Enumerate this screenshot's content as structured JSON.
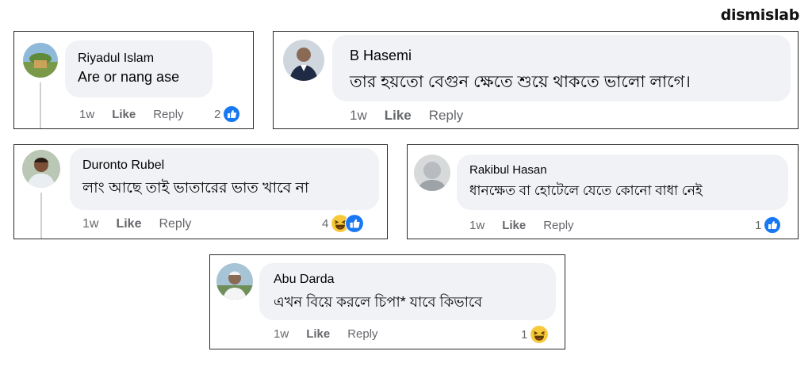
{
  "brand": "dismislab",
  "colors": {
    "like_blue": "#1877f2",
    "bubble_bg": "#f0f2f5",
    "haha_yellow": "#f7c93a"
  },
  "comments": [
    {
      "name": "Riyadul Islam",
      "text": "Are or nang ase",
      "time": "1w",
      "like": "Like",
      "reply": "Reply",
      "reactions": "2",
      "reaction_icons": [
        "like-icon"
      ]
    },
    {
      "name": "B Hasemi",
      "text": "তার হয়তো বেগুন ক্ষেতে শুয়ে থাকতে ভালো লাগে।",
      "time": "1w",
      "like": "Like",
      "reply": "Reply",
      "reactions": "",
      "reaction_icons": []
    },
    {
      "name": "Duronto Rubel",
      "text": "লাং আছে তাই ভাতারের ভাত খাবে না",
      "time": "1w",
      "like": "Like",
      "reply": "Reply",
      "reactions": "4",
      "reaction_icons": [
        "haha-icon",
        "like-icon"
      ]
    },
    {
      "name": "Rakibul Hasan",
      "text": "ধানক্ষেত বা হোটেলে যেতে কোনো বাধা নেই",
      "time": "1w",
      "like": "Like",
      "reply": "Reply",
      "reactions": "1",
      "reaction_icons": [
        "like-icon"
      ]
    },
    {
      "name": "Abu Darda",
      "text": "এখন বিয়ে করলে চিপা* যাবে কিভাবে",
      "time": "1w",
      "like": "Like",
      "reply": "Reply",
      "reactions": "1",
      "reaction_icons": [
        "haha-icon"
      ]
    }
  ]
}
